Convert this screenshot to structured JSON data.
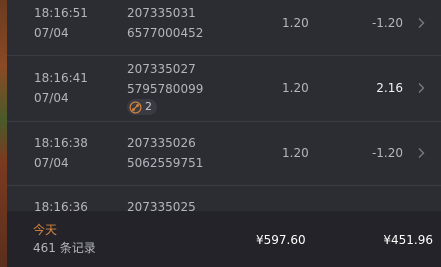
{
  "rows": [
    {
      "time": "18:16:51",
      "date": "07/04",
      "id_line1": "207335031",
      "id_line2": "6577000452",
      "price": "1.20",
      "change": "-1.20",
      "change_positive": false
    },
    {
      "time": "18:16:41",
      "date": "07/04",
      "id_line1": "207335027",
      "id_line2": "5795780099",
      "badge_count": "2",
      "price": "1.20",
      "change": "2.16",
      "change_positive": true
    },
    {
      "time": "18:16:38",
      "date": "07/04",
      "id_line1": "207335026",
      "id_line2": "5062559751",
      "price": "1.20",
      "change": "-1.20",
      "change_positive": false
    },
    {
      "time": "18:16:36",
      "id_line1": "207335025"
    }
  ],
  "footer": {
    "today_label": "今天",
    "record_count": "461 条记录",
    "total_1": "¥597.60",
    "total_2": "¥451.96"
  },
  "colors": {
    "background": "#2c2c33",
    "footer_background": "#232329",
    "accent_orange": "#d5863f",
    "text_muted": "#b5b5bd",
    "text_bright": "#f2f2f4"
  },
  "icons": {
    "row_chevron": "chevron-right-icon",
    "badge_icon": "link-circle-icon"
  }
}
